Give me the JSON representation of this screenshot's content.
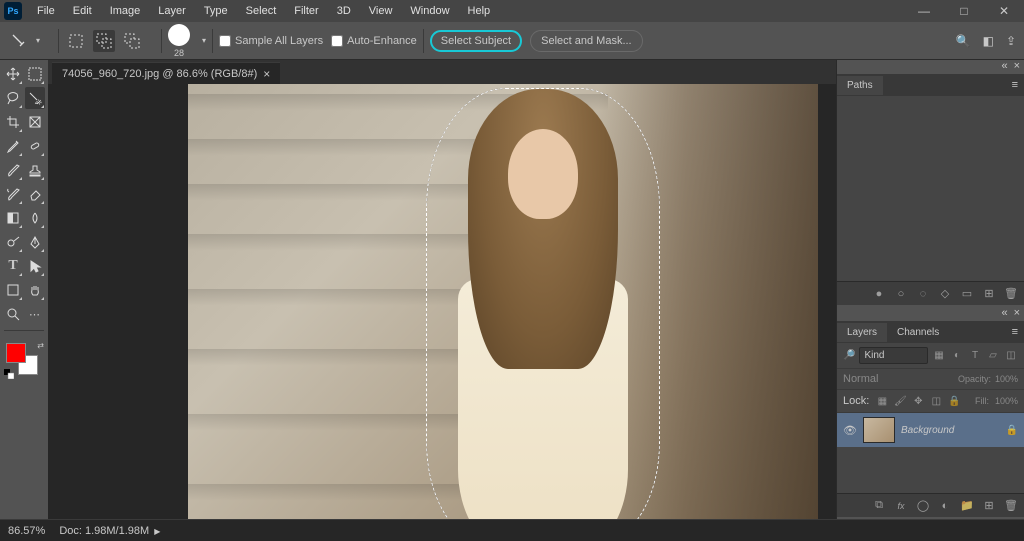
{
  "menu": {
    "items": [
      "File",
      "Edit",
      "Image",
      "Layer",
      "Type",
      "Select",
      "Filter",
      "3D",
      "View",
      "Window",
      "Help"
    ]
  },
  "options": {
    "brush_size": "28",
    "sample_all_layers": "Sample All Layers",
    "auto_enhance": "Auto-Enhance",
    "select_subject": "Select Subject",
    "select_and_mask": "Select and Mask..."
  },
  "document": {
    "tab_title": "74056_960_720.jpg @ 86.6% (RGB/8#)"
  },
  "colors": {
    "foreground": "#ff0000",
    "background": "#ffffff"
  },
  "panels": {
    "paths": {
      "tab": "Paths"
    },
    "layers": {
      "tab_layers": "Layers",
      "tab_channels": "Channels",
      "kind": "Kind",
      "blend_mode": "Normal",
      "opacity_label": "Opacity:",
      "opacity_value": "100%",
      "lock_label": "Lock:",
      "fill_label": "Fill:",
      "fill_value": "100%",
      "items": [
        {
          "name": "Background",
          "locked": true,
          "visible": true
        }
      ]
    }
  },
  "status": {
    "zoom": "86.57%",
    "doc_info": "Doc: 1.98M/1.98M"
  },
  "icons": {
    "minimize": "—",
    "maximize": "□",
    "close": "✕",
    "search": "🔍",
    "frame": "◧",
    "share": "⇪",
    "dropdown": "▾",
    "tab_close": "×",
    "swap_colors": "⇄",
    "eye": "👁",
    "lock": "🔒",
    "trash": "🗑",
    "new": "⊞",
    "folder": "📁",
    "link": "⧉",
    "fx": "fx",
    "mask": "◯",
    "adjust": "◐",
    "fill_circle": "●",
    "stroke_circle": "○",
    "panel_menu": "≡",
    "collapse": "«",
    "ctrl_close": "×"
  }
}
